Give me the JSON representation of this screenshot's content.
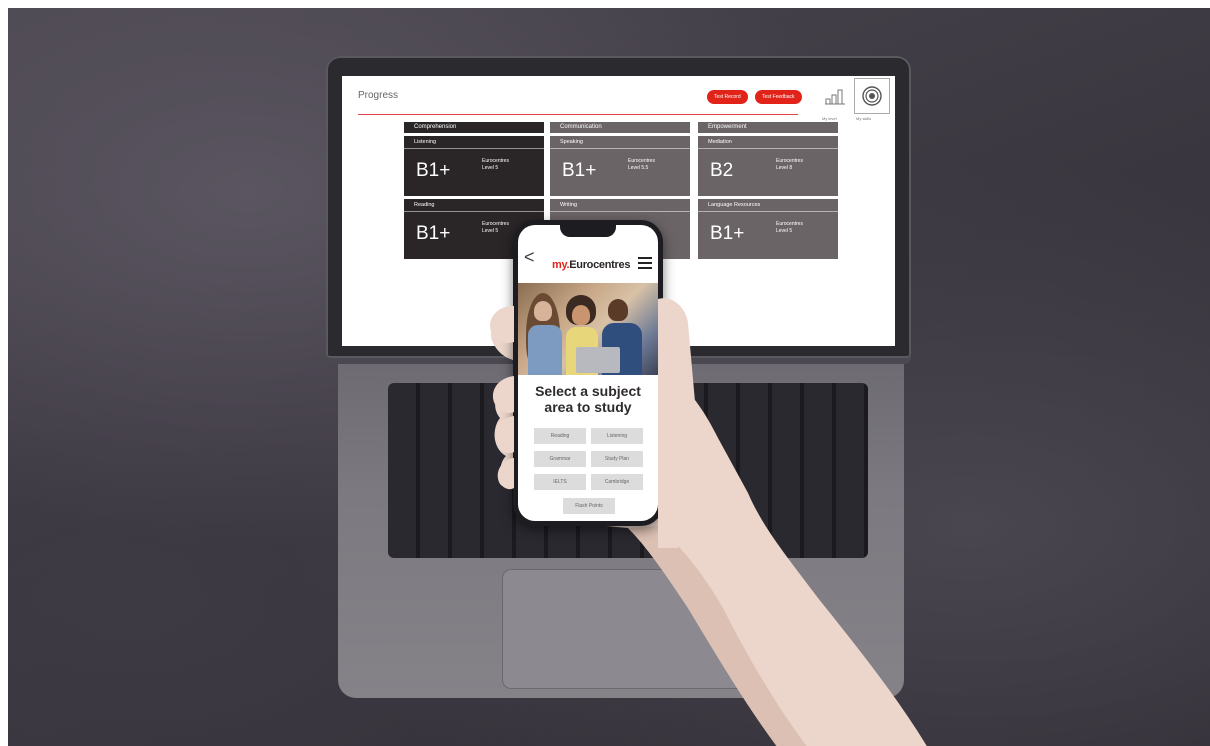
{
  "desktop": {
    "title": "Progress",
    "buttons": {
      "test_record": "Test Record",
      "test_feedback": "Test Feedback"
    },
    "icons": {
      "my_level_label": "My level",
      "my_skills_label": "My skills"
    },
    "columns": [
      {
        "header": "Comprehension",
        "cards": [
          {
            "title": "Listening",
            "level": "B1+",
            "sub1": "Eurocentres",
            "sub2": "Level 5"
          },
          {
            "title": "Reading",
            "level": "B1+",
            "sub1": "Eurocentres",
            "sub2": "Level 5"
          }
        ]
      },
      {
        "header": "Communication",
        "cards": [
          {
            "title": "Speaking",
            "level": "B1+",
            "sub1": "Eurocentres",
            "sub2": "Level 5.5"
          },
          {
            "title": "Writing",
            "level": "",
            "sub1": "",
            "sub2": ""
          }
        ]
      },
      {
        "header": "Empowerment",
        "cards": [
          {
            "title": "Mediation",
            "level": "B2",
            "sub1": "Eurocentres",
            "sub2": "Level 8"
          },
          {
            "title": "Language Resources",
            "level": "B1+",
            "sub1": "Eurocentres",
            "sub2": "Level 5"
          }
        ]
      }
    ]
  },
  "mobile": {
    "back_glyph": "<",
    "logo_prefix": "my.",
    "logo_name": "Eurocentres",
    "heading_line1": "Select a subject",
    "heading_line2": "area to study",
    "subjects": [
      "Reading",
      "Listening",
      "Grammar",
      "Study Plan",
      "IELTS",
      "Cambridge",
      "Flash Points"
    ]
  },
  "colors": {
    "brand_red": "#e2231a",
    "card_dark": "#2a2527",
    "card_gray": "#6b6466"
  }
}
